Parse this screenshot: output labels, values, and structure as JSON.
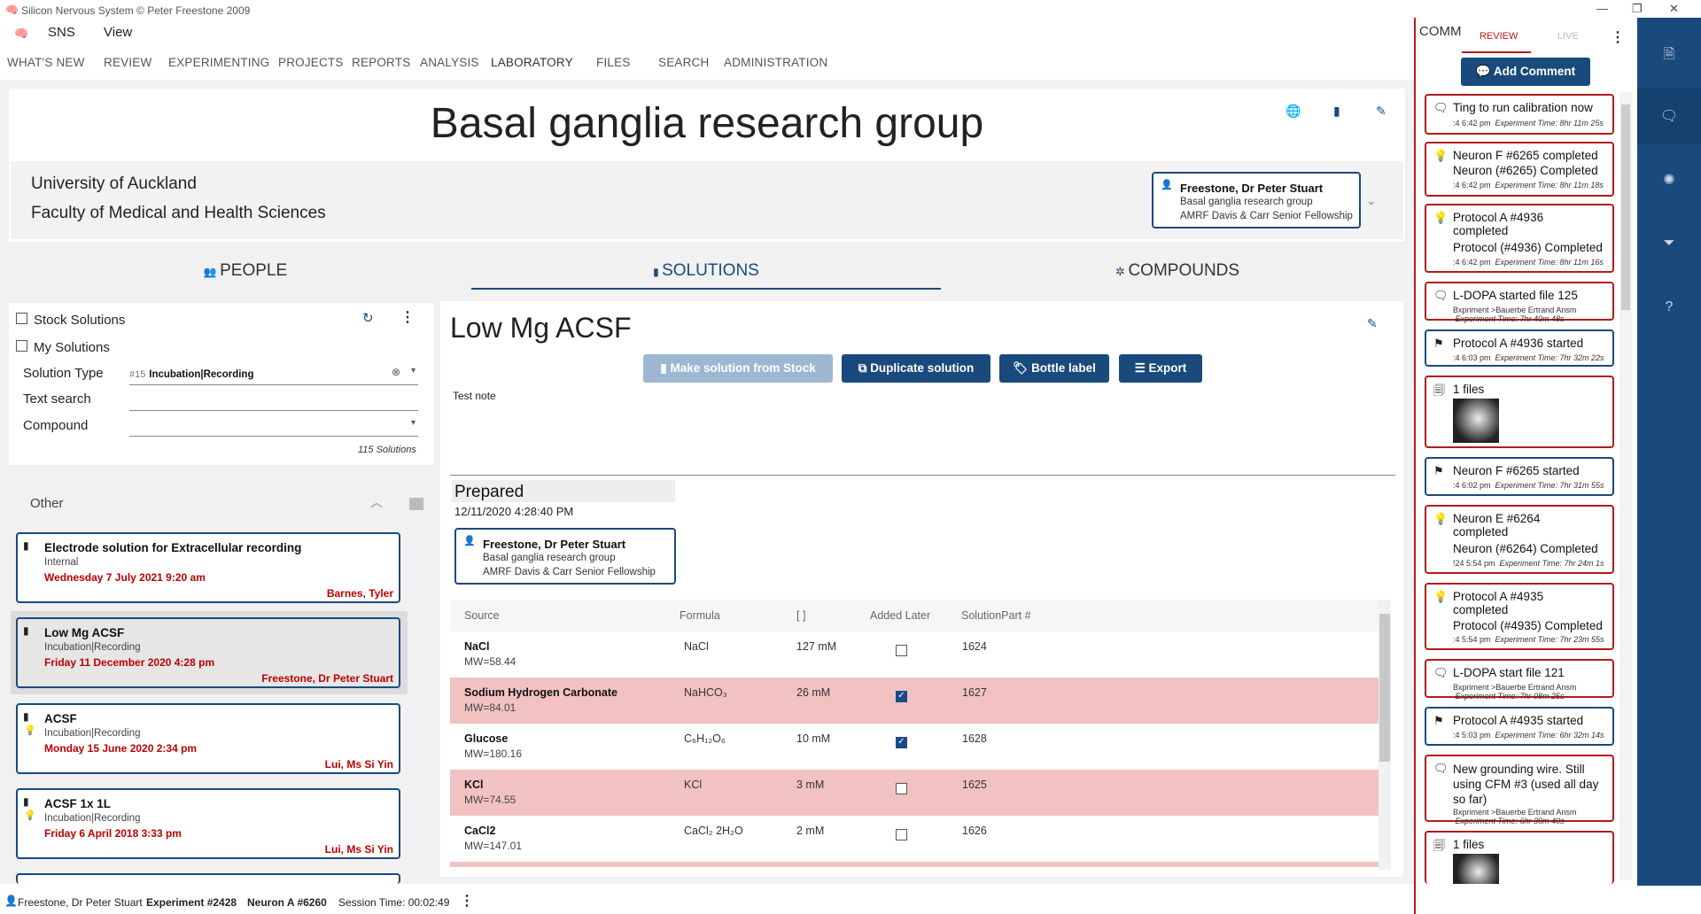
{
  "app": {
    "title": "Silicon Nervous System © Peter Freestone 2009"
  },
  "menu": [
    "SNS",
    "View"
  ],
  "nav": [
    "WHAT'S NEW",
    "REVIEW",
    "EXPERIMENTING",
    "PROJECTS",
    "REPORTS",
    "ANALYSIS",
    "LABORATORY",
    "FILES",
    "SEARCH",
    "ADMINISTRATION"
  ],
  "group": {
    "title": "Basal ganglia research group",
    "org1": "University of Auckland",
    "org2": "Faculty of Medical and Health Sciences",
    "leader": {
      "name": "Freestone, Dr Peter Stuart",
      "line1": "Basal ganglia research group",
      "line2": "AMRF Davis & Carr Senior Fellowship"
    }
  },
  "tabs": {
    "people": "PEOPLE",
    "solutions": "SOLUTIONS",
    "compounds": "COMPOUNDS"
  },
  "filters": {
    "stock": "Stock Solutions",
    "mine": "My Solutions",
    "type_label": "Solution Type",
    "type_prefix": "#15",
    "type_value": "Incubation|Recording",
    "text_label": "Text search",
    "compound_label": "Compound",
    "count": "115 Solutions"
  },
  "list": {
    "header": "Other",
    "items": [
      {
        "title": "Electrode solution for Extracellular recording",
        "sub": "Internal",
        "date": "Wednesday 7 July 2021 9:20 am",
        "author": "Barnes,  Tyler"
      },
      {
        "title": "Low Mg ACSF",
        "sub": "Incubation|Recording",
        "date": "Friday 11 December 2020 4:28 pm",
        "author": "Freestone, Dr Peter Stuart"
      },
      {
        "title": "ACSF",
        "sub": "Incubation|Recording",
        "date": "Monday 15 June 2020 2:34 pm",
        "author": "Lui, Ms Si Yin"
      },
      {
        "title": "ACSF 1x 1L",
        "sub": "Incubation|Recording",
        "date": "Friday 6 April 2018 3:33 pm",
        "author": "Lui, Ms Si Yin"
      }
    ]
  },
  "detail": {
    "title": "Low Mg ACSF",
    "btn_stock": "Make solution from Stock",
    "btn_dup": "Duplicate solution",
    "btn_label": "Bottle label",
    "btn_export": "Export",
    "note": "Test note",
    "prepared": "Prepared",
    "prepared_date": "12/11/2020 4:28:40 PM",
    "preparer": {
      "name": "Freestone, Dr Peter Stuart",
      "line1": "Basal ganglia research group",
      "line2": "AMRF Davis & Carr Senior Fellowship"
    },
    "cols": [
      "Source",
      "Formula",
      "[ ]",
      "Added Later",
      "SolutionPart #"
    ],
    "rows": [
      {
        "source": "NaCl",
        "mw": "MW=58.44",
        "formula": "NaCl",
        "conc": "127 mM",
        "later": false,
        "part": "1624"
      },
      {
        "source": "Sodium Hydrogen Carbonate",
        "mw": "MW=84.01",
        "formula": "NaHCO₃",
        "conc": "26 mM",
        "later": true,
        "part": "1627"
      },
      {
        "source": "Glucose",
        "mw": "MW=180.16",
        "formula": "C₆H₁₂O₆",
        "conc": "10 mM",
        "later": true,
        "part": "1628"
      },
      {
        "source": "KCl",
        "mw": "MW=74.55",
        "formula": "KCl",
        "conc": "3 mM",
        "later": false,
        "part": "1625"
      },
      {
        "source": "CaCl2",
        "mw": "MW=147.01",
        "formula": "CaCl₂ 2H₂O",
        "conc": "2 mM",
        "later": false,
        "part": "1626"
      }
    ]
  },
  "status": {
    "user": "Freestone, Dr Peter Stuart",
    "experiment": "Experiment #2428",
    "neuron": "Neuron A #6260",
    "session": "Session Time: 00:02:49"
  },
  "comments": {
    "title": "COMM",
    "tab_review": "REVIEW",
    "tab_live": "LIVE",
    "add": "Add Comment",
    "items": [
      {
        "title": "Ting to run calibration now",
        "time": ":4 6:42 pm",
        "exp": "Experiment Time: 8hr 11m 25s"
      },
      {
        "title": "Neuron F #6265 completed",
        "body": "Neuron (#6265) Completed",
        "time": ":4 6:42 pm",
        "exp": "Experiment Time: 8hr 11m 18s"
      },
      {
        "title": "Protocol A #4936 completed",
        "body": "Protocol (#4936) Completed",
        "time": ":4 6:42 pm",
        "exp": "Experiment Time: 8hr 11m 16s"
      },
      {
        "title": "L-DOPA started file 125",
        "time": "Bxpriment >Bauerbe Ertrand Ansm",
        "exp": "Experiment Time: 7hr 40m 48s"
      },
      {
        "title": "Protocol A #4936 started",
        "time": ":4 6:03 pm",
        "exp": "Experiment Time: 7hr 32m 22s"
      },
      {
        "title": "1 files"
      },
      {
        "title": "Neuron F #6265 started",
        "time": ":4 6:02 pm",
        "exp": "Experiment Time: 7hr 31m 55s"
      },
      {
        "title": "Neuron E #6264 completed",
        "body": "Neuron (#6264) Completed",
        "time": "!24 5:54 pm",
        "exp": "Experiment Time: 7hr 24m 1s"
      },
      {
        "title": "Protocol A #4935 completed",
        "body": "Protocol (#4935) Completed",
        "time": ":4 5:54 pm",
        "exp": "Experiment Time: 7hr 23m 55s"
      },
      {
        "title": "L-DOPA start file 121",
        "time": "Bxpriment >Bauerbe Ertrand Ansm",
        "exp": "Experiment Time: 7hr 08m 25s"
      },
      {
        "title": "Protocol A #4935 started",
        "time": ":4 5:03 pm",
        "exp": "Experiment Time: 6hr 32m 14s"
      },
      {
        "title": "New grounding wire. Still using CFM #3 (used all day so far)",
        "time": "Bxpriment >Bauerbe Ertrand Ansm",
        "exp": "Experiment Time: 6hr 30m 40s"
      },
      {
        "title": "1 files"
      }
    ]
  },
  "colors": {
    "brand": "#1a4a7c",
    "alert": "#b31b1b",
    "pink": "#f2c2c2"
  }
}
